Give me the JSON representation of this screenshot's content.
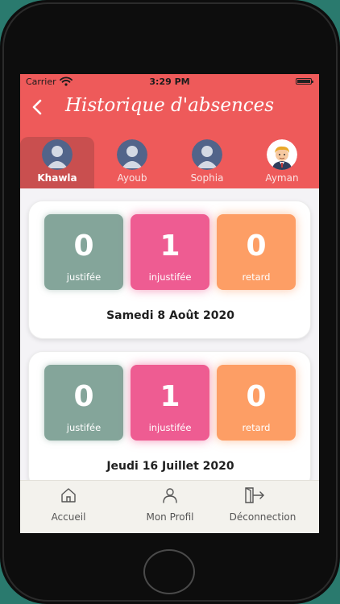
{
  "status_bar": {
    "carrier": "Carrier",
    "time": "3:29 PM"
  },
  "header": {
    "title": "Historique d'absences"
  },
  "students": [
    {
      "name": "Khawla",
      "active": true,
      "avatar": "avatar-placeholder-icon"
    },
    {
      "name": "Ayoub",
      "active": false,
      "avatar": "avatar-placeholder-icon"
    },
    {
      "name": "Sophia",
      "active": false,
      "avatar": "avatar-placeholder-icon"
    },
    {
      "name": "Ayman",
      "active": false,
      "avatar": "cartoon-boy-avatar"
    }
  ],
  "records": [
    {
      "justified": {
        "value": "0",
        "label": "justifée"
      },
      "unjustified": {
        "value": "1",
        "label": "injustifée"
      },
      "late": {
        "value": "0",
        "label": "retard"
      },
      "date": "Samedi 8 Août 2020"
    },
    {
      "justified": {
        "value": "0",
        "label": "justifée"
      },
      "unjustified": {
        "value": "1",
        "label": "injustifée"
      },
      "late": {
        "value": "0",
        "label": "retard"
      },
      "date": "Jeudi 16 Juillet 2020"
    }
  ],
  "bottom_nav": [
    {
      "label": "Accueil",
      "icon": "home-icon"
    },
    {
      "label": "Mon Profil",
      "icon": "profile-icon"
    },
    {
      "label": "Déconnection",
      "icon": "logout-icon"
    }
  ],
  "colors": {
    "header": "#ee5a5a",
    "active_tab": "#c94f4f",
    "justified": "#84a59a",
    "unjustified": "#ee5c92",
    "late": "#fd9e65"
  }
}
